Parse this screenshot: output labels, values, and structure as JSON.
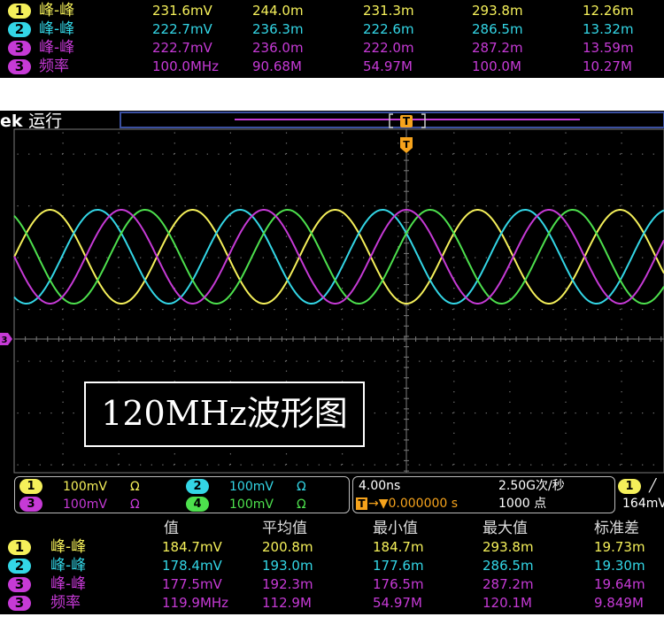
{
  "colors": {
    "ch1": "#f5f05a",
    "ch2": "#33d6e6",
    "ch3": "#c63ad6",
    "ch4": "#4de04d",
    "trigger": "#f6a31c",
    "grid": "#7a7a7a",
    "panel_bg": "#000000"
  },
  "top_table": {
    "rows": [
      {
        "ch": "1",
        "label": "峰-峰",
        "value": "231.6mV",
        "mean": "244.0m",
        "min": "231.3m",
        "max": "293.8m",
        "std": "12.26m"
      },
      {
        "ch": "2",
        "label": "峰-峰",
        "value": "222.7mV",
        "mean": "236.3m",
        "min": "222.6m",
        "max": "286.5m",
        "std": "13.32m"
      },
      {
        "ch": "3",
        "label": "峰-峰",
        "value": "222.7mV",
        "mean": "236.0m",
        "min": "222.0m",
        "max": "287.2m",
        "std": "13.59m"
      },
      {
        "ch": "3",
        "label": "频率",
        "value": "100.0MHz",
        "mean": "90.68M",
        "min": "54.97M",
        "max": "100.0M",
        "std": "10.27M"
      }
    ]
  },
  "scope": {
    "brand": "ek",
    "status": "运行",
    "trigger_marker": "T",
    "ch_marker": "3",
    "overlay_title": "120MHz波形图"
  },
  "settings": {
    "channels": [
      {
        "ch": "1",
        "volts": "100mV",
        "unit": "Ω",
        "color": "ch1"
      },
      {
        "ch": "2",
        "volts": "100mV",
        "unit": "Ω",
        "color": "ch2"
      },
      {
        "ch": "3",
        "volts": "100mV",
        "unit": "Ω",
        "color": "ch3"
      },
      {
        "ch": "4",
        "volts": "100mV",
        "unit": "Ω",
        "color": "ch4"
      }
    ],
    "timebase": "4.00ns",
    "sample_rate": "2.50G次/秒",
    "trigger_label": "T",
    "trigger_delay": "→▼0.000000 s",
    "record_length": "1000 点",
    "trig_ch": "1",
    "trig_slope": "╱",
    "trig_level": "164mV"
  },
  "bottom_table": {
    "headers": [
      "值",
      "平均值",
      "最小值",
      "最大值",
      "标准差"
    ],
    "rows": [
      {
        "ch": "1",
        "label": "峰-峰",
        "value": "184.7mV",
        "mean": "200.8m",
        "min": "184.7m",
        "max": "293.8m",
        "std": "19.73m"
      },
      {
        "ch": "2",
        "label": "峰-峰",
        "value": "178.4mV",
        "mean": "193.0m",
        "min": "177.6m",
        "max": "286.5m",
        "std": "19.30m"
      },
      {
        "ch": "3",
        "label": "峰-峰",
        "value": "177.5mV",
        "mean": "192.3m",
        "min": "176.5m",
        "max": "287.2m",
        "std": "19.64m"
      },
      {
        "ch": "3",
        "label": "频率",
        "value": "119.9MHz",
        "mean": "112.9M",
        "min": "54.97M",
        "max": "120.1M",
        "std": "9.849M"
      }
    ]
  }
}
